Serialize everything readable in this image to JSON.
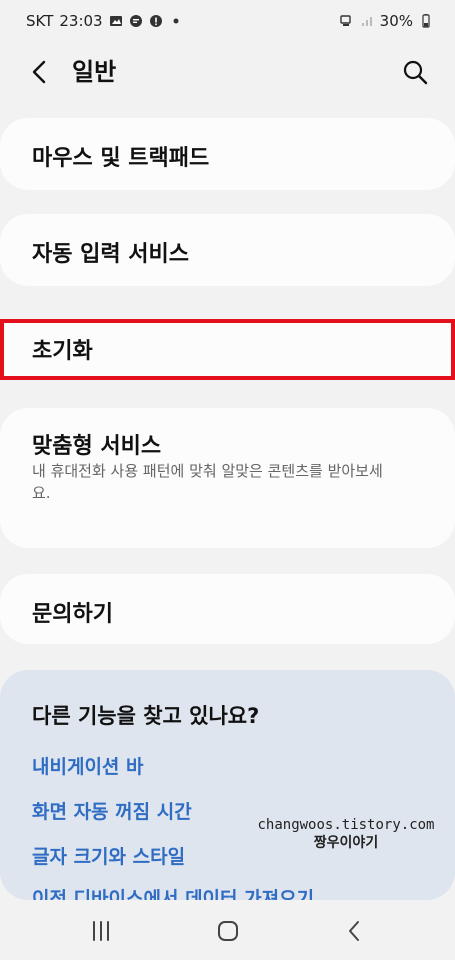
{
  "status": {
    "carrier": "SKT",
    "time": "23:03",
    "battery": "30%"
  },
  "header": {
    "title": "일반"
  },
  "menu": {
    "items": [
      {
        "label": "마우스 및 트랙패드"
      },
      {
        "label": "자동 입력 서비스"
      },
      {
        "label": "초기화"
      },
      {
        "label": "맞춤형 서비스",
        "description": "내 휴대전화 사용 패턴에 맞춰 알맞은 콘텐츠를 받아보세요."
      },
      {
        "label": "문의하기"
      }
    ]
  },
  "suggestions": {
    "title": "다른 기능을 찾고 있나요?",
    "links": [
      "내비게이션 바",
      "화면 자동 꺼짐 시간",
      "글자 크기와 스타일",
      "이전 디바이스에서 데이터 가져오기"
    ]
  },
  "watermark": {
    "url": "changwoos.tistory.com",
    "name": "짱우이야기"
  },
  "colors": {
    "highlight": "#e3101b",
    "link": "#2f6cc4",
    "hint_bg": "#dfe5ee"
  },
  "icons": {
    "back": "chevron-left-icon",
    "search": "search-icon",
    "recents": "recents-icon",
    "home": "home-icon",
    "nav_back": "nav-back-icon"
  }
}
